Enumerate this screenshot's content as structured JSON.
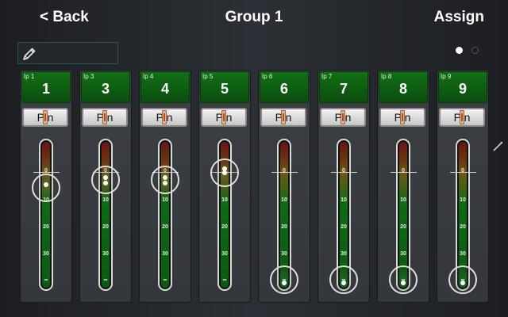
{
  "header": {
    "back_label": "< Back",
    "title": "Group 1",
    "assign_label": "Assign"
  },
  "name_field": {
    "value": ""
  },
  "pager": {
    "pages": 2,
    "current": 1
  },
  "fader_scale": [
    "0",
    "10",
    "20",
    "30",
    "∞"
  ],
  "pan_label": "P  n",
  "channels": [
    {
      "label": "Ip 1",
      "number": "1",
      "fader_db": "6",
      "pan": "center"
    },
    {
      "label": "Ip 3",
      "number": "3",
      "fader_db": "3",
      "pan": "center"
    },
    {
      "label": "Ip 4",
      "number": "4",
      "fader_db": "3",
      "pan": "center"
    },
    {
      "label": "Ip 5",
      "number": "5",
      "fader_db": "-2",
      "pan": "center"
    },
    {
      "label": "Ip 6",
      "number": "6",
      "fader_db": "-∞",
      "pan": "center"
    },
    {
      "label": "Ip 7",
      "number": "7",
      "fader_db": "-∞",
      "pan": "center"
    },
    {
      "label": "Ip 8",
      "number": "8",
      "fader_db": "-∞",
      "pan": "center"
    },
    {
      "label": "Ip 9",
      "number": "9",
      "fader_db": "-∞",
      "pan": "center"
    }
  ],
  "icons": {
    "edit": "pencil-icon",
    "side": "pen-nib-icon"
  },
  "colors": {
    "channel_header": "#137016",
    "name_border": "#1f5a4e",
    "meter_green": "#0e6a14",
    "meter_red": "#6a1414"
  }
}
